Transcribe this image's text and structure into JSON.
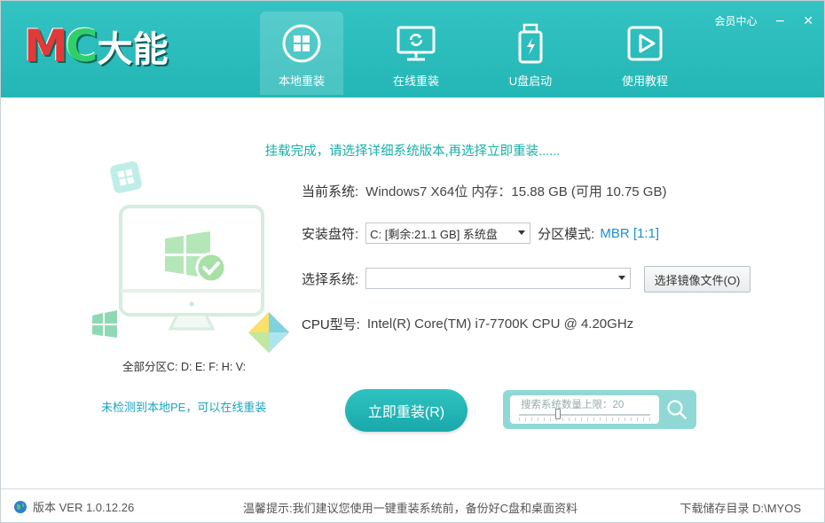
{
  "header": {
    "logo_mc_m": "M",
    "logo_mc_c": "C",
    "logo_cn": "大能",
    "member_center": "会员中心",
    "minimize": "−",
    "close": "✕",
    "nav": [
      {
        "label": "本地重装",
        "icon": "windows-icon"
      },
      {
        "label": "在线重装",
        "icon": "monitor-sync-icon"
      },
      {
        "label": "U盘启动",
        "icon": "usb-icon"
      },
      {
        "label": "使用教程",
        "icon": "video-play-icon"
      }
    ]
  },
  "main": {
    "hint": "挂载完成，请选择详细系统版本,再选择立即重装......",
    "current_system_label": "当前系统:",
    "current_system_value": "Windows7 X64位 内存：15.88 GB (可用 10.75 GB)",
    "install_drive_label": "安装盘符:",
    "install_drive_value": "C:  [剩余:21.1 GB]  系统盘",
    "partition_mode_label": "分区模式:",
    "partition_mode_value": "MBR [1:1]",
    "select_system_label": "选择系统:",
    "select_system_value": "",
    "select_image_button": "选择镜像文件(O)",
    "cpu_label": "CPU型号:",
    "cpu_value": "Intel(R) Core(TM) i7-7700K CPU @ 4.20GHz",
    "install_button": "立即重装(R)",
    "search_placeholder": "搜索系统数量上限：20",
    "search_limit_fraction": 0.3
  },
  "left": {
    "partitions": "全部分区C: D: E: F: H: V:",
    "pe_status": "未检测到本地PE，可以在线重装"
  },
  "status": {
    "version": "版本 VER 1.0.12.26",
    "tip": "温馨提示:我们建议您使用一键重装系统前，备份好C盘和桌面资料",
    "download_dir": "下载储存目录 D:\\MYOS"
  },
  "colors": {
    "header": "#26b8b8",
    "accent_text": "#19b0a8",
    "link_blue": "#1c8fd1"
  }
}
